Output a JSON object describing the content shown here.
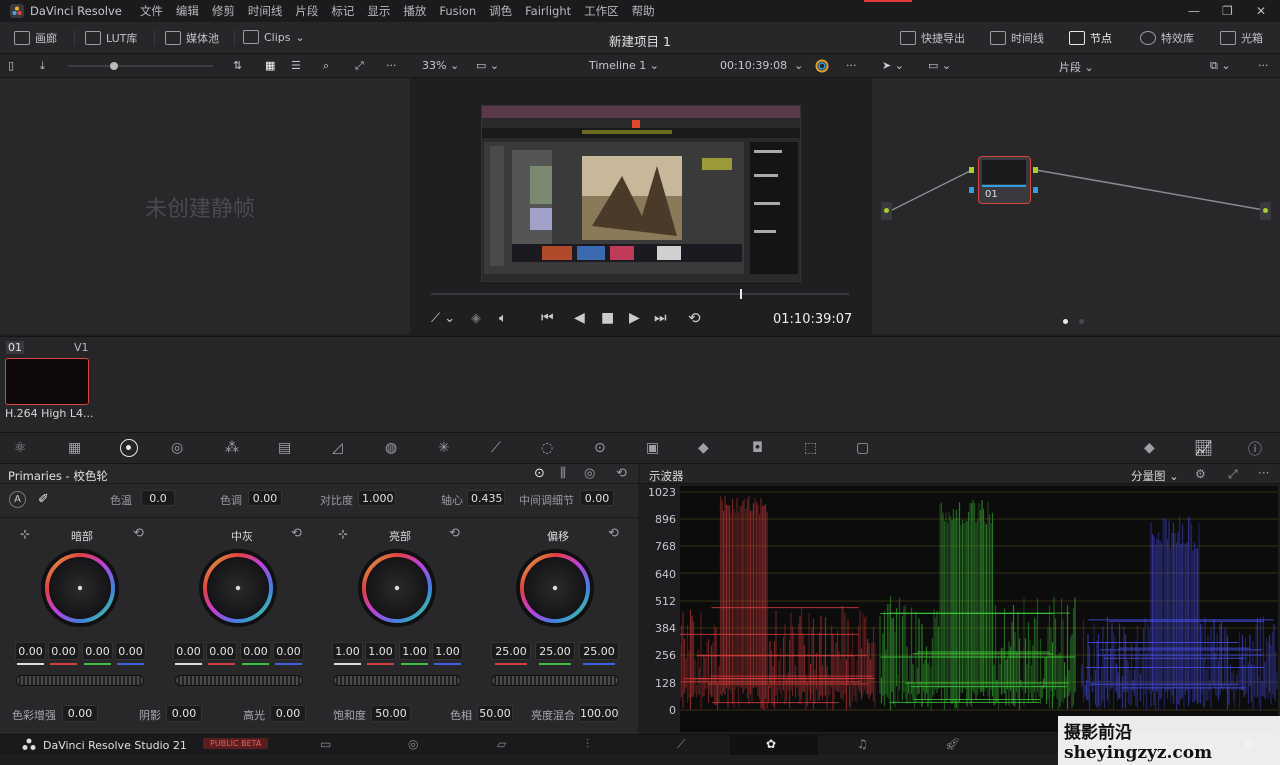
{
  "menubar": {
    "app_name": "DaVinci Resolve",
    "items": [
      "文件",
      "编辑",
      "修剪",
      "时间线",
      "片段",
      "标记",
      "显示",
      "播放",
      "Fusion",
      "调色",
      "Fairlight",
      "工作区",
      "帮助"
    ]
  },
  "toolbar": {
    "left": [
      {
        "label": "画廊",
        "icon": "gallery-icon"
      },
      {
        "label": "LUT库",
        "icon": "lut-icon"
      },
      {
        "label": "媒体池",
        "icon": "media-pool-icon"
      },
      {
        "label": "Clips",
        "icon": "clips-icon"
      }
    ],
    "project_title": "新建项目 1",
    "right": [
      {
        "label": "快捷导出",
        "icon": "export-icon"
      },
      {
        "label": "时间线",
        "icon": "timeline-icon"
      },
      {
        "label": "节点",
        "icon": "nodes-icon"
      },
      {
        "label": "特效库",
        "icon": "fx-icon"
      },
      {
        "label": "光箱",
        "icon": "lightbox-icon"
      }
    ]
  },
  "viewer": {
    "zoom": "33%",
    "timeline_name": "Timeline 1",
    "timecode_top": "00:10:39:08",
    "timecode_bottom": "01:10:39:07",
    "scrub_position": 0.74
  },
  "gallery": {
    "empty_text": "未创建静帧"
  },
  "node_editor": {
    "mode_label": "片段",
    "node_label": "01"
  },
  "clips": [
    {
      "number": "01",
      "track": "V1",
      "name": "H.264 High L4..."
    }
  ],
  "primaries": {
    "title": "Primaries - 校色轮",
    "top_params": [
      {
        "label": "色温",
        "value": "0.0"
      },
      {
        "label": "色调",
        "value": "0.00"
      },
      {
        "label": "对比度",
        "value": "1.000"
      },
      {
        "label": "轴心",
        "value": "0.435"
      },
      {
        "label": "中间调细节",
        "value": "0.00"
      }
    ],
    "wheels": [
      {
        "name": "暗部",
        "values": [
          "0.00",
          "0.00",
          "0.00",
          "0.00"
        ]
      },
      {
        "name": "中灰",
        "values": [
          "0.00",
          "0.00",
          "0.00",
          "0.00"
        ]
      },
      {
        "name": "亮部",
        "values": [
          "1.00",
          "1.00",
          "1.00",
          "1.00"
        ]
      },
      {
        "name": "偏移",
        "values": [
          "25.00",
          "25.00",
          "25.00"
        ]
      }
    ],
    "bottom_params": [
      {
        "label": "色彩增强",
        "value": "0.00"
      },
      {
        "label": "阴影",
        "value": "0.00"
      },
      {
        "label": "高光",
        "value": "0.00"
      },
      {
        "label": "饱和度",
        "value": "50.00"
      },
      {
        "label": "色相",
        "value": "50.00"
      },
      {
        "label": "亮度混合",
        "value": "100.00"
      }
    ]
  },
  "scopes": {
    "title": "示波器",
    "mode": "分量图",
    "y_ticks": [
      "1023",
      "896",
      "768",
      "640",
      "512",
      "384",
      "256",
      "128",
      "0"
    ]
  },
  "status": {
    "app_version": "DaVinci Resolve Studio 21",
    "badge": "PUBLIC BETA"
  },
  "watermark": "摄影前沿 sheyingzyz.com",
  "colors": {
    "accent_red": "#e03a3a",
    "node_outline": "#d8473a",
    "scope_red": "#e03c3c",
    "scope_green": "#3ecf3a",
    "scope_blue": "#4a50f0"
  }
}
